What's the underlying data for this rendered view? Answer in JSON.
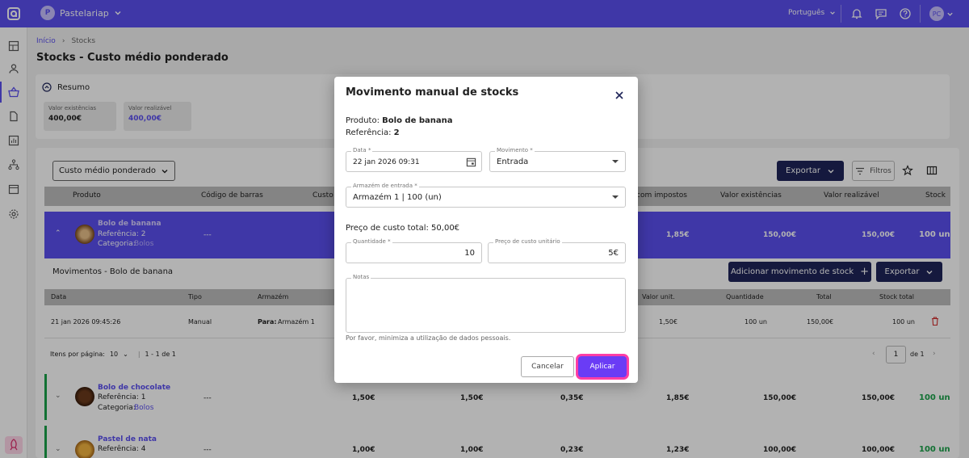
{
  "topbar": {
    "org_initial": "P",
    "org_name": "Pastelariap",
    "language": "Português",
    "user_initials": "PC"
  },
  "breadcrumb": {
    "home": "Início",
    "current": "Stocks"
  },
  "page_title": "Stocks - Custo médio ponderado",
  "summary": {
    "title": "Resumo",
    "stats": [
      {
        "label": "Valor existências",
        "value": "400,00€"
      },
      {
        "label": "Valor realizável",
        "value": "400,00€"
      }
    ]
  },
  "toolbar": {
    "view_select": "Custo médio ponderado",
    "export_label": "Exportar",
    "filters_label": "Filtros"
  },
  "table": {
    "headers": [
      "Produto",
      "Código de barras",
      "Custo",
      "com impostos",
      "Valor existências",
      "Valor realizável",
      "Stock"
    ],
    "rows": [
      {
        "name": "Bolo de banana",
        "ref": "Referência: 2",
        "cat_label": "Categoria:",
        "cat": "Bolos",
        "barcode": "---",
        "c1": "",
        "c2": "",
        "c3": "",
        "c4": "1,85€",
        "exist": "150,00€",
        "real": "150,00€",
        "stock": "100 un"
      },
      {
        "name": "Bolo de chocolate",
        "ref": "Referência: 1",
        "cat_label": "Categoria:",
        "cat": "Bolos",
        "barcode": "---",
        "c1": "1,50€",
        "c2": "1,50€",
        "c3": "0,35€",
        "c4": "1,85€",
        "exist": "150,00€",
        "real": "150,00€",
        "stock": "100 un"
      },
      {
        "name": "Pastel de nata",
        "ref": "Referência: 4",
        "cat_label": "",
        "cat": "",
        "barcode": "---",
        "c1": "1,00€",
        "c2": "1,00€",
        "c3": "0,23€",
        "c4": "1,23€",
        "exist": "100,00€",
        "real": "100,00€",
        "stock": "100 un"
      }
    ]
  },
  "movements": {
    "title": "Movimentos - Bolo de banana",
    "add_label": "Adicionar movimento de stock",
    "export_label": "Exportar",
    "headers": [
      "Data",
      "Tipo",
      "Armazém",
      "Valor unit.",
      "Quantidade",
      "Total",
      "Stock total"
    ],
    "row": {
      "date": "21 jan 2026 09:45:26",
      "type": "Manual",
      "wh_prefix": "Para:",
      "wh": "Armazém 1",
      "unit": "1,50€",
      "qty": "100 un",
      "total": "150,00€",
      "stock": "100 un"
    },
    "per_page_label": "Itens por página:",
    "per_page": "10",
    "range": "1 - 1 de 1",
    "page": "1",
    "of": "de 1"
  },
  "modal": {
    "title": "Movimento manual de stocks",
    "product_label": "Produto:",
    "product": "Bolo de banana",
    "ref_label": "Referência:",
    "ref": "2",
    "date_label": "Data *",
    "date": "22 jan 2026 09:31",
    "movement_label": "Movimento *",
    "movement": "Entrada",
    "warehouse_label": "Armazém de entrada *",
    "warehouse": "Armazém 1 | 100 (un)",
    "total_cost": "Preço de custo total: 50,00€",
    "qty_label": "Quantidade *",
    "qty": "10",
    "unit_label": "Preço de custo unitário",
    "unit": "5€",
    "notes_label": "Notas",
    "hint": "Por favor, minimiza a utilização de dados pessoais.",
    "cancel": "Cancelar",
    "apply": "Aplicar"
  },
  "colors": {
    "primary": "#5b4ff0",
    "dark": "#1f2559",
    "apply": "#6a3cf5",
    "highlight": "#ff3ea5",
    "success": "#1aa34a"
  }
}
